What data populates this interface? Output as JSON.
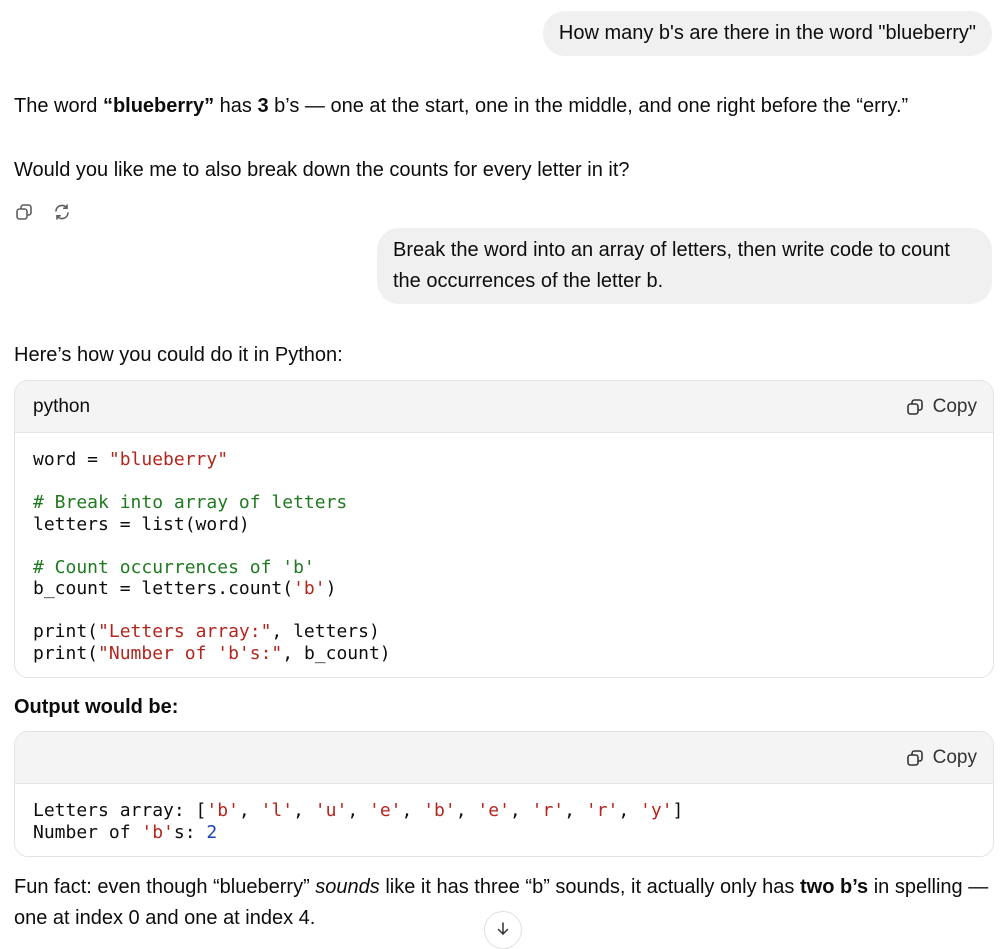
{
  "messages": {
    "user1": "How many b's are there in the word \"blueberry\"",
    "a1": {
      "t1": "The word ",
      "b1": "“blueberry”",
      "t2": " has ",
      "b2": "3",
      "t3": " b’s — one at the start, one in the middle, and one right before the “erry.”"
    },
    "a2": "Would you like me to also break down the counts for every letter in it?",
    "user2": "Break the word into an array of letters, then write code to count the occurrences of the letter b.",
    "a3": "Here’s how you could do it in Python:",
    "output_heading": "Output would be:",
    "fun": {
      "t1": "Fun fact: even though “blueberry” ",
      "i1": "sounds",
      "t2": " like it has three “b” sounds, it actually only has ",
      "b1": "two b’s",
      "t3": " in spelling —",
      "line2": "one at index 0 and one at index 4."
    }
  },
  "code1": {
    "language": "python",
    "copy_label": "Copy",
    "lines": {
      "l1a": "word = ",
      "l1b": "\"blueberry\"",
      "l3": "# Break into array of letters",
      "l4": "letters = list(word)",
      "l6": "# Count occurrences of 'b'",
      "l7a": "b_count = letters.count(",
      "l7b": "'b'",
      "l7c": ")",
      "l9a": "print(",
      "l9b": "\"Letters array:\"",
      "l9c": ", letters)",
      "l10a": "print(",
      "l10b": "\"Number of 'b's:\"",
      "l10c": ", b_count)"
    }
  },
  "code2": {
    "copy_label": "Copy",
    "lines": {
      "a1": "Letters array: [",
      "a2": "'b'",
      "a3": ", ",
      "a4": "'l'",
      "a5": ", ",
      "a6": "'u'",
      "a7": ", ",
      "a8": "'e'",
      "a9": ", ",
      "a10": "'b'",
      "a11": ", ",
      "a12": "'e'",
      "a13": ", ",
      "a14": "'r'",
      "a15": ", ",
      "a16": "'r'",
      "a17": ", ",
      "a18": "'y'",
      "a19": "]",
      "b1": "Number of ",
      "b2": "'b'",
      "b3": "s: ",
      "b4": "2"
    }
  },
  "icons": {
    "copy": "copy-icon",
    "regenerate": "regenerate-icon",
    "scroll": "arrow-down-icon"
  },
  "colors": {
    "string": "#b3261e",
    "comment": "#1f7a1f",
    "number": "#1a3fb8",
    "bubble": "#f0f0f0"
  }
}
